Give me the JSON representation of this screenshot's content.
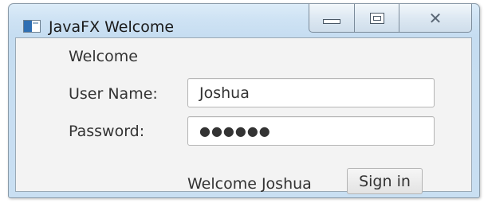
{
  "window": {
    "title": "JavaFX Welcome",
    "buttons": {
      "minimize_icon": "minimize-icon",
      "maximize_icon": "maximize-icon",
      "close_icon": "close-icon",
      "close_glyph": "✕"
    }
  },
  "form": {
    "heading": "Welcome",
    "username_label": "User Name:",
    "username_value": "Joshua",
    "password_label": "Password:",
    "password_value": "●●●●●●",
    "status_text": "Welcome Joshua",
    "sign_in_label": "Sign in"
  },
  "colors": {
    "titlebar": "#c9dff2",
    "content_bg": "#f3f3f3",
    "text": "#333333"
  }
}
